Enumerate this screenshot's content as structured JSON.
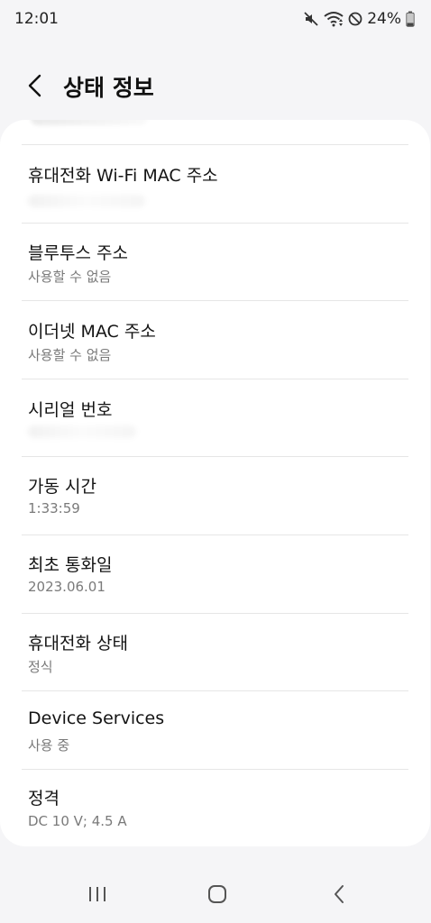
{
  "status_bar": {
    "time": "12:01",
    "battery_percent": "24%",
    "battery_level": 0.24,
    "icons": [
      "mute-icon",
      "wifi-icon",
      "do-not-disturb-icon",
      "battery-icon"
    ]
  },
  "header": {
    "title": "상태 정보",
    "back_icon": "chevron-left-icon"
  },
  "rows": [
    {
      "title": "휴대전화 Wi-Fi MAC 주소",
      "subtitle": ""
    },
    {
      "title": "블루투스 주소",
      "subtitle": "사용할 수 없음"
    },
    {
      "title": "이더넷 MAC 주소",
      "subtitle": "사용할 수 없음"
    },
    {
      "title": "시리얼 번호",
      "subtitle": ""
    },
    {
      "title": "가동 시간",
      "subtitle": "1:33:59"
    },
    {
      "title": "최초 통화일",
      "subtitle": "2023.06.01"
    },
    {
      "title": "휴대전화 상태",
      "subtitle": "정식"
    },
    {
      "title": "Device Services",
      "subtitle": "사용 중"
    },
    {
      "title": "정격",
      "subtitle": "DC 10 V; 4.5 A"
    }
  ],
  "nav_bar": {
    "icons": [
      "recent-apps-icon",
      "home-icon",
      "back-icon"
    ]
  },
  "colors": {
    "background": "#f5f5f7",
    "card": "#ffffff",
    "title_text": "#141414",
    "subtitle_text": "#7a7a7a",
    "divider": "#e6e6e6"
  }
}
